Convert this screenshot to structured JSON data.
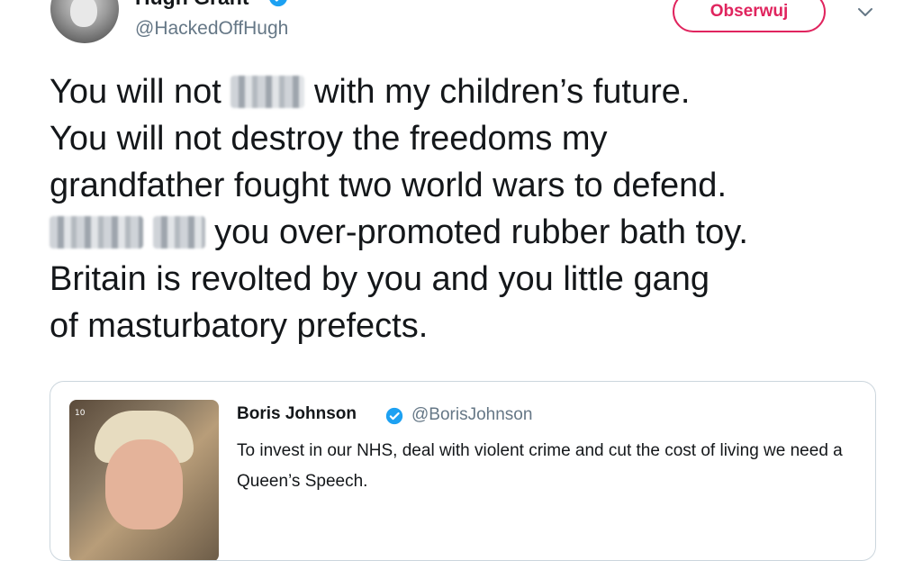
{
  "author": {
    "name": "Hugh Grant",
    "handle": "@HackedOffHugh",
    "verified": true,
    "avatar_icon": "profile-photo"
  },
  "header": {
    "follow_label": "Obserwuj",
    "menu_icon": "chevron-down-icon"
  },
  "tweet": {
    "lines": [
      {
        "before": "You will not ",
        "after": " with my children’s future."
      },
      {
        "text": "You will not destroy the freedoms my"
      },
      {
        "text": "grandfather fought two world wars to defend."
      },
      {
        "after": " you over-promoted rubber bath toy."
      },
      {
        "text": "Britain is revolted by you and you little gang"
      },
      {
        "text": "of masturbatory prefects."
      }
    ]
  },
  "quoted_tweet": {
    "name": "Boris Johnson",
    "handle": "@BorisJohnson",
    "verified": true,
    "text": "To invest in our NHS, deal with violent crime and cut the cost of living we need a Queen’s Speech.",
    "image_tag": "10"
  },
  "colors": {
    "accent": "#e0245e",
    "verified": "#1da1f2",
    "secondary_text": "#657786",
    "border": "#ccd6dd"
  }
}
